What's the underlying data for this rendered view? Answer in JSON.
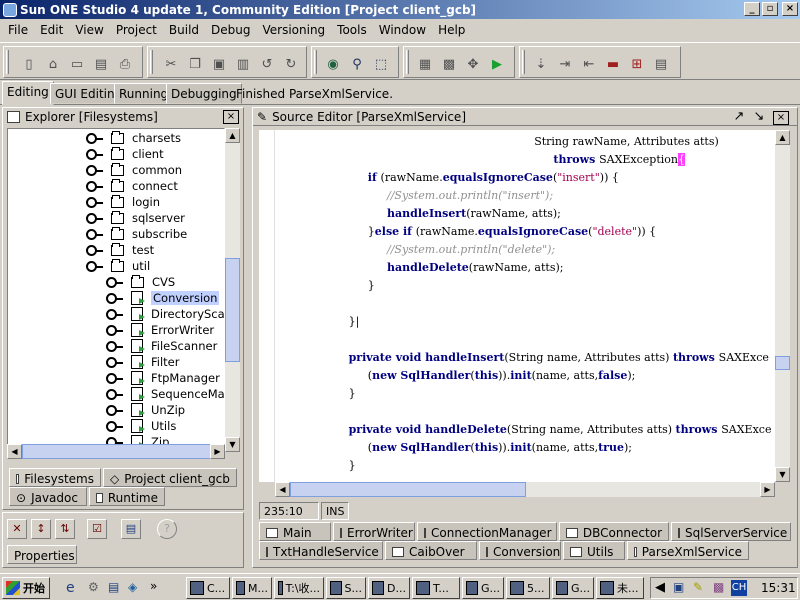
{
  "window": {
    "title": "Sun ONE Studio 4 update 1, Community Edition [Project client_gcb]",
    "controls": [
      "_",
      "▫",
      "×"
    ]
  },
  "menu": [
    "File",
    "Edit",
    "View",
    "Project",
    "Build",
    "Debug",
    "Versioning",
    "Tools",
    "Window",
    "Help"
  ],
  "mode_tabs": [
    "Editing",
    "GUI Editing",
    "Running",
    "Debugging"
  ],
  "status_message": "Finished ParseXmlService.",
  "explorer": {
    "title": "Explorer [Filesystems]",
    "tree": [
      {
        "label": "charsets",
        "type": "folder"
      },
      {
        "label": "client",
        "type": "folder"
      },
      {
        "label": "common",
        "type": "folder"
      },
      {
        "label": "connect",
        "type": "folder"
      },
      {
        "label": "login",
        "type": "folder"
      },
      {
        "label": "sqlserver",
        "type": "folder"
      },
      {
        "label": "subscribe",
        "type": "folder"
      },
      {
        "label": "test",
        "type": "folder"
      },
      {
        "label": "util",
        "type": "folder-open"
      },
      {
        "label": "CVS",
        "type": "folder"
      },
      {
        "label": "Conversion",
        "type": "java"
      },
      {
        "label": "DirectoryScan",
        "type": "java"
      },
      {
        "label": "ErrorWriter",
        "type": "java"
      },
      {
        "label": "FileScanner",
        "type": "java"
      },
      {
        "label": "Filter",
        "type": "java"
      },
      {
        "label": "FtpManager",
        "type": "java"
      },
      {
        "label": "SequenceMan",
        "type": "java"
      },
      {
        "label": "UnZip",
        "type": "java"
      },
      {
        "label": "Utils",
        "type": "java"
      },
      {
        "label": "Zip",
        "type": "java"
      }
    ],
    "tabs": [
      "Filesystems",
      "Project client_gcb",
      "Javadoc",
      "Runtime"
    ]
  },
  "properties": {
    "tab": "Properties"
  },
  "editor": {
    "title": "Source Editor [ParseXmlService]",
    "lines": [
      {
        "indent": 43,
        "parts": [
          [
            "t",
            "String rawName, Attributes atts)"
          ]
        ]
      },
      {
        "indent": 46,
        "parts": [
          [
            "k",
            "throws "
          ],
          [
            "t",
            "SAXException"
          ],
          [
            "c",
            "{"
          ]
        ]
      },
      {
        "indent": 17,
        "parts": [
          [
            "k",
            "if "
          ],
          [
            "t",
            "(rawName."
          ],
          [
            "k",
            "equalsIgnoreCase"
          ],
          [
            "t",
            "("
          ],
          [
            "s",
            "\"insert\""
          ],
          [
            "t",
            ")) {"
          ]
        ]
      },
      {
        "indent": 20,
        "parts": [
          [
            "m",
            "//System.out.println(\"insert\");"
          ]
        ]
      },
      {
        "indent": 20,
        "parts": [
          [
            "k",
            "handleInsert"
          ],
          [
            "t",
            "(rawName, atts);"
          ]
        ]
      },
      {
        "indent": 17,
        "parts": [
          [
            "t",
            "}"
          ],
          [
            "k",
            "else if "
          ],
          [
            "t",
            "(rawName."
          ],
          [
            "k",
            "equalsIgnoreCase"
          ],
          [
            "t",
            "("
          ],
          [
            "s",
            "\"delete\""
          ],
          [
            "t",
            ")) {"
          ]
        ]
      },
      {
        "indent": 20,
        "parts": [
          [
            "m",
            "//System.out.println(\"delete\");"
          ]
        ]
      },
      {
        "indent": 20,
        "parts": [
          [
            "k",
            "handleDelete"
          ],
          [
            "t",
            "(rawName, atts);"
          ]
        ]
      },
      {
        "indent": 17,
        "parts": [
          [
            "t",
            "}"
          ]
        ]
      },
      {
        "indent": 0,
        "parts": [
          [
            "t",
            ""
          ]
        ]
      },
      {
        "indent": 14,
        "parts": [
          [
            "t",
            "}|"
          ]
        ]
      },
      {
        "indent": 0,
        "parts": [
          [
            "t",
            ""
          ]
        ]
      },
      {
        "indent": 14,
        "parts": [
          [
            "k",
            "private void "
          ],
          [
            "k",
            "handleInsert"
          ],
          [
            "t",
            "(String name, Attributes atts) "
          ],
          [
            "k",
            "throws "
          ],
          [
            "t",
            "SAXExce"
          ]
        ]
      },
      {
        "indent": 17,
        "parts": [
          [
            "t",
            "("
          ],
          [
            "k",
            "new "
          ],
          [
            "k",
            "SqlHandler"
          ],
          [
            "t",
            "("
          ],
          [
            "k",
            "this"
          ],
          [
            "t",
            "))."
          ],
          [
            "k",
            "init"
          ],
          [
            "t",
            "(name, atts,"
          ],
          [
            "k",
            "false"
          ],
          [
            "t",
            ");"
          ]
        ]
      },
      {
        "indent": 14,
        "parts": [
          [
            "t",
            "}"
          ]
        ]
      },
      {
        "indent": 0,
        "parts": [
          [
            "t",
            ""
          ]
        ]
      },
      {
        "indent": 14,
        "parts": [
          [
            "k",
            "private void "
          ],
          [
            "k",
            "handleDelete"
          ],
          [
            "t",
            "(String name, Attributes atts) "
          ],
          [
            "k",
            "throws "
          ],
          [
            "t",
            "SAXExce"
          ]
        ]
      },
      {
        "indent": 17,
        "parts": [
          [
            "t",
            "("
          ],
          [
            "k",
            "new "
          ],
          [
            "k",
            "SqlHandler"
          ],
          [
            "t",
            "("
          ],
          [
            "k",
            "this"
          ],
          [
            "t",
            "))."
          ],
          [
            "k",
            "init"
          ],
          [
            "t",
            "(name, atts,"
          ],
          [
            "k",
            "true"
          ],
          [
            "t",
            ");"
          ]
        ]
      },
      {
        "indent": 14,
        "parts": [
          [
            "t",
            "}"
          ]
        ]
      }
    ],
    "status_position": "235:10",
    "status_mode": "INS",
    "tabs_row1": [
      "Main",
      "ErrorWriter",
      "ConnectionManager",
      "DBConnector",
      "SqlServerService"
    ],
    "tabs_row2": [
      "TxtHandleService",
      "CaibOver",
      "Conversion",
      "Utils",
      "ParseXmlService"
    ]
  },
  "taskbar": {
    "start": "开始",
    "quick_launch_more": "»",
    "tasks": [
      "C...",
      "M...",
      "T:\\收...",
      "S...",
      "D...",
      "T...",
      "G...",
      "5...",
      "G...",
      "未..."
    ],
    "tray_lang": "CH",
    "clock": "15:31"
  }
}
